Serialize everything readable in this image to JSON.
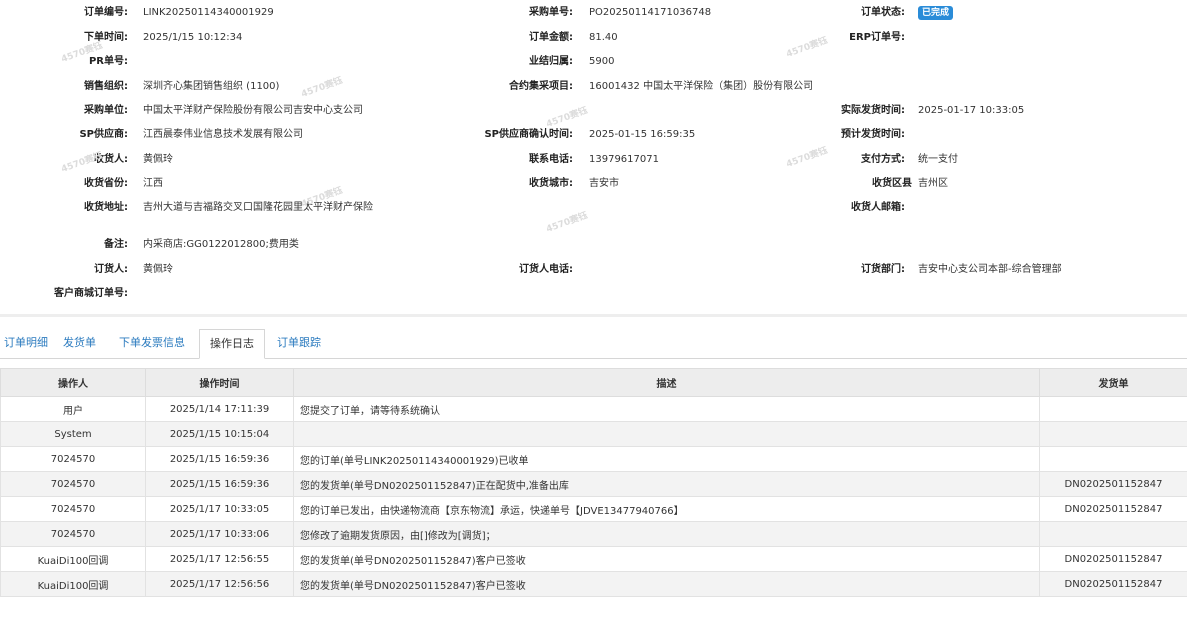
{
  "order": {
    "order_no_label": "订单编号:",
    "order_no": "LINK20250114340001929",
    "po_no_label": "采购单号:",
    "po_no": "PO20250114171036748",
    "status_label": "订单状态:",
    "status": "已完成",
    "status_color": "#2a8cd8",
    "order_time_label": "下单时间:",
    "order_time": "2025/1/15 10:12:34",
    "amount_label": "订单金额:",
    "amount": "81.40",
    "erp_label": "ERP订单号:",
    "erp": "",
    "pr_label": "PR单号:",
    "pr": "",
    "business_label": "业结归属:",
    "business": "5900",
    "sales_org_label": "销售组织:",
    "sales_org": "深圳齐心集团销售组织 (1100)",
    "contract_label": "合约集采项目:",
    "contract": "16001432 中国太平洋保险（集团）股份有限公司",
    "buyer_label": "采购单位:",
    "buyer": "中国太平洋财产保险股份有限公司吉安中心支公司",
    "ship_time_label": "实际发货时间:",
    "ship_time": "2025-01-17 10:33:05",
    "supplier_label": "SP供应商:",
    "supplier": "江西晨泰伟业信息技术发展有限公司",
    "supplier_confirm_label": "SP供应商确认时间:",
    "supplier_confirm": "2025-01-15 16:59:35",
    "est_ship_label": "预计发货时间:",
    "est_ship": "",
    "receiver_label": "收货人:",
    "receiver": "黄佩玲",
    "phone_label": "联系电话:",
    "phone": "13979617071",
    "pay_label": "支付方式:",
    "pay": "统一支付",
    "province_label": "收货省份:",
    "province": "江西",
    "city_label": "收货城市:",
    "city": "吉安市",
    "district_label": "收货区县",
    "district": "吉州区",
    "address_label": "收货地址:",
    "address": "吉州大道与吉福路交叉口国隆花园里太平洋财产保险",
    "email_label": "收货人邮箱:",
    "email": "",
    "remark_label": "备注:",
    "remark": "内采商店:GG0122012800;费用类",
    "orderer_label": "订货人:",
    "orderer": "黄佩玲",
    "orderer_phone_label": "订货人电话:",
    "orderer_phone": "",
    "dept_label": "订货部门:",
    "dept": "吉安中心支公司本部-综合管理部",
    "mall_label": "客户商城订单号:",
    "mall": ""
  },
  "watermark": "4570赛钰",
  "tabs": [
    "订单明细",
    "发货单",
    "下单发票信息",
    "操作日志",
    "订单跟踪"
  ],
  "table": {
    "headers": [
      "操作人",
      "操作时间",
      "描述",
      "发货单"
    ],
    "rows": [
      [
        "用户",
        "2025/1/14 17:11:39",
        "您提交了订单，请等待系统确认",
        ""
      ],
      [
        "System",
        "2025/1/15 10:15:04",
        "",
        ""
      ],
      [
        "7024570",
        "2025/1/15 16:59:36",
        "您的订单(单号LINK20250114340001929)已收单",
        ""
      ],
      [
        "7024570",
        "2025/1/15 16:59:36",
        "您的发货单(单号DN0202501152847)正在配货中,准备出库",
        "DN0202501152847"
      ],
      [
        "7024570",
        "2025/1/17 10:33:05",
        "您的订单已发出，由快递物流商【京东物流】承运，快递单号【JDVE13477940766】",
        "DN0202501152847"
      ],
      [
        "7024570",
        "2025/1/17 10:33:06",
        "您修改了逾期发货原因，由[]修改为[调货]；",
        ""
      ],
      [
        "KuaiDi100回调",
        "2025/1/17 12:56:55",
        "您的发货单(单号DN0202501152847)客户已签收",
        "DN0202501152847"
      ],
      [
        "KuaiDi100回调",
        "2025/1/17 12:56:56",
        "您的发货单(单号DN0202501152847)客户已签收",
        "DN0202501152847"
      ]
    ]
  }
}
